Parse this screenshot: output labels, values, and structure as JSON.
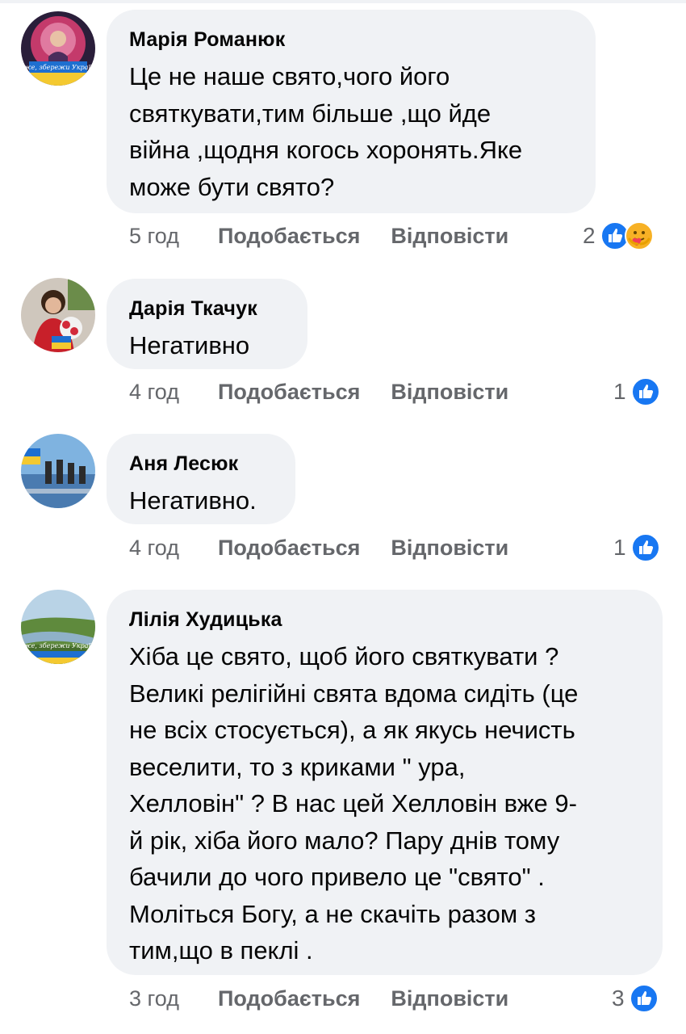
{
  "like_label": "Подобається",
  "reply_label": "Відповісти",
  "colors": {
    "bubble": "#f0f2f5",
    "meta_text": "#65676b",
    "like_blue": "#1877f2",
    "care_yellow": "#f7b125"
  },
  "comments": [
    {
      "author": "Марія Романюк",
      "text": "Це не наше свято,чого його\nсвяткувати,тим більше ,що йде\nвійна ,щодня когось хоронять.Яке\nможе бути свято?",
      "time": "5 год",
      "reaction_count": "2",
      "reactions": [
        "like-icon",
        "care-icon"
      ],
      "avatar_caption": "Боже, збережи Україну!"
    },
    {
      "author": "Дарія Ткачук",
      "text": "Негативно",
      "time": "4 год",
      "reaction_count": "1",
      "reactions": [
        "like-icon"
      ]
    },
    {
      "author": "Аня Лесюк",
      "text": "Негативно.",
      "time": "4 год",
      "reaction_count": "1",
      "reactions": [
        "like-icon"
      ]
    },
    {
      "author": "Лілія Худицька",
      "text": "Хіба це свято, щоб його святкувати ?\nВеликі релігійні свята вдома сидіть (це\nне всіх стосується), а як якусь нечисть\nвеселити, то з криками \" ура,\nХелловін\" ? В нас цей Хелловін вже 9-\nй рік, хіба його мало? Пару днів тому\nбачили до чого привело це \"свято\" .\nМоліться Богу, а не скачіть разом з\nтим,що в пеклі .",
      "time": "3 год",
      "reaction_count": "3",
      "reactions": [
        "like-icon"
      ],
      "avatar_caption": "Боже, збережи Україну!"
    }
  ]
}
